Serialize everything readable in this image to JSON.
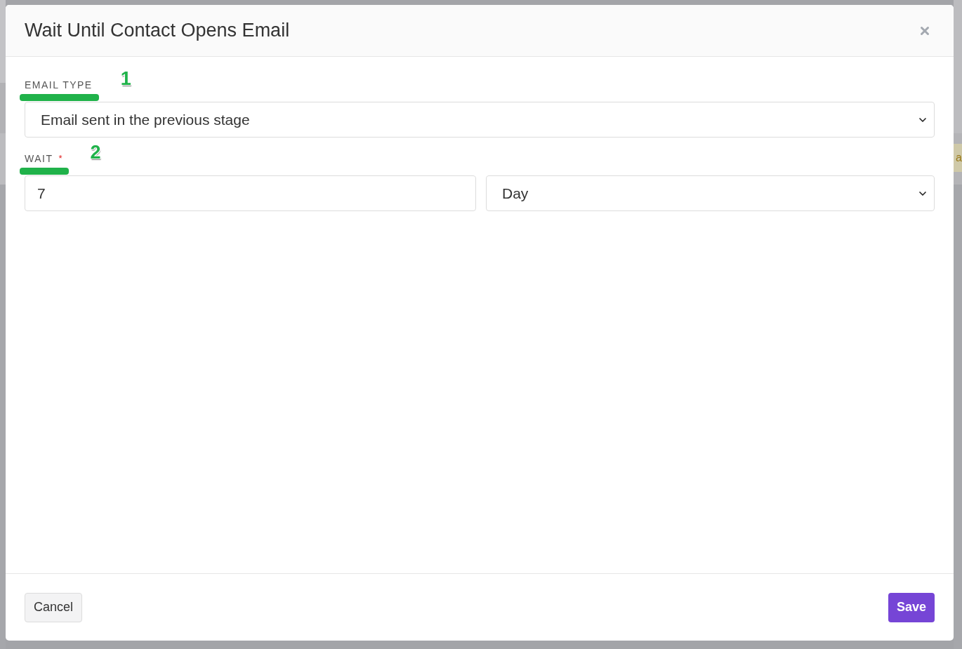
{
  "dialog": {
    "title": "Wait Until Contact Opens Email"
  },
  "fields": [
    {
      "kind": "select",
      "label": "EMAIL TYPE",
      "required": false,
      "value": "Email sent in the previous stage",
      "annotation": {
        "number": "1",
        "underline": true
      }
    },
    {
      "kind": "number_with_unit",
      "label": "WAIT",
      "required": true,
      "required_mark": "*",
      "value": "7",
      "unit": "Day",
      "annotation": {
        "number": "2",
        "underline": true
      }
    }
  ],
  "buttons": [
    {
      "label": "Cancel",
      "kind": "secondary"
    },
    {
      "label": "Save",
      "kind": "primary"
    }
  ],
  "background_page": {
    "tag_fragment": "a"
  }
}
